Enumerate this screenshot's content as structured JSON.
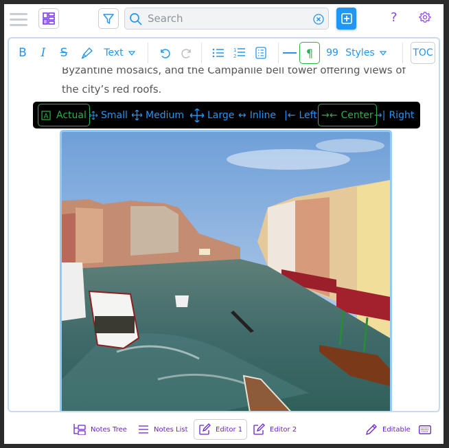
{
  "topbar": {
    "search_placeholder": "Search",
    "search_value": "",
    "icons": {
      "menu": "hamburger-icon",
      "layout": "layout-panels-icon",
      "filter": "filter-icon",
      "search": "search-icon",
      "clear": "clear-circle-icon",
      "add": "add-note-icon",
      "help": "help-icon",
      "settings": "gear-icon"
    },
    "help_glyph": "?"
  },
  "toolbar": {
    "bold": "B",
    "italic": "I",
    "strike": "S",
    "text_label": "Text",
    "quote_label": "99",
    "styles_label": "Styles",
    "toc_label": "TOC",
    "paragraph_glyph": "¶",
    "hr_glyph": "—"
  },
  "content": {
    "paragraph_partial": "Byzantine mosaics, and the Campanile bell tower offering views of",
    "paragraph_end": "the city’s red roofs."
  },
  "image_toolbar": {
    "items": [
      {
        "label": "Actual",
        "glyph": "🄰",
        "active": true
      },
      {
        "label": "Small",
        "glyph": "✥",
        "active": false
      },
      {
        "label": "Medium",
        "glyph": "✥",
        "active": false
      },
      {
        "label": "Large",
        "glyph": "✥",
        "active": false
      },
      {
        "label": "Inline",
        "glyph": "↔",
        "active": false
      },
      {
        "label": "Left",
        "glyph": "|←",
        "active": false
      },
      {
        "label": "Center",
        "glyph": "→←",
        "active": true
      },
      {
        "label": "Right",
        "glyph": "→|",
        "active": false
      }
    ]
  },
  "image": {
    "description": "Grand Canal in Venice with boats and gondolas"
  },
  "bottombar": {
    "notes_tree": "Notes Tree",
    "notes_list": "Notes List",
    "editor1": "Editor 1",
    "editor2": "Editor 2",
    "editable": "Editable"
  },
  "colors": {
    "accent_blue": "#2196f3",
    "active_green": "#2bb24c",
    "purple": "#6a1fd1"
  }
}
